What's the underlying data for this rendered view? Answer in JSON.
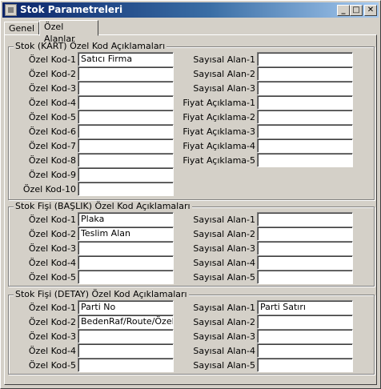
{
  "window": {
    "title": "Stok Parametreleri",
    "minimize_glyph": "_",
    "maximize_glyph": "□",
    "close_glyph": "✕"
  },
  "tabs": [
    {
      "label": "Genel",
      "active": false
    },
    {
      "label": "Özel Alanlar",
      "active": true
    }
  ],
  "groups": [
    {
      "title": "Stok (KART)  Özel Kod Açıklamaları",
      "left_fields": [
        {
          "label": "Özel Kod-1",
          "value": "Satıcı Firma"
        },
        {
          "label": "Özel Kod-2",
          "value": ""
        },
        {
          "label": "Özel Kod-3",
          "value": ""
        },
        {
          "label": "Özel Kod-4",
          "value": ""
        },
        {
          "label": "Özel Kod-5",
          "value": ""
        },
        {
          "label": "Özel Kod-6",
          "value": ""
        },
        {
          "label": "Özel Kod-7",
          "value": ""
        },
        {
          "label": "Özel Kod-8",
          "value": ""
        },
        {
          "label": "Özel Kod-9",
          "value": ""
        },
        {
          "label": "Özel Kod-10",
          "value": ""
        }
      ],
      "right_fields": [
        {
          "label": "Sayısal Alan-1",
          "value": ""
        },
        {
          "label": "Sayısal Alan-2",
          "value": ""
        },
        {
          "label": "Sayısal Alan-3",
          "value": ""
        },
        {
          "label": "Fiyat Açıklama-1",
          "value": ""
        },
        {
          "label": "Fiyat Açıklama-2",
          "value": ""
        },
        {
          "label": "Fiyat Açıklama-3",
          "value": ""
        },
        {
          "label": "Fiyat Açıklama-4",
          "value": ""
        },
        {
          "label": "Fiyat Açıklama-5",
          "value": ""
        }
      ]
    },
    {
      "title": "Stok Fişi  (BAŞLIK)  Özel Kod Açıklamaları",
      "left_fields": [
        {
          "label": "Özel Kod-1",
          "value": "Plaka"
        },
        {
          "label": "Özel Kod-2",
          "value": "Teslim Alan"
        },
        {
          "label": "Özel Kod-3",
          "value": ""
        },
        {
          "label": "Özel Kod-4",
          "value": ""
        },
        {
          "label": "Özel Kod-5",
          "value": ""
        }
      ],
      "right_fields": [
        {
          "label": "Sayısal Alan-1",
          "value": ""
        },
        {
          "label": "Sayısal Alan-2",
          "value": ""
        },
        {
          "label": "Sayısal Alan-3",
          "value": ""
        },
        {
          "label": "Sayısal Alan-4",
          "value": ""
        },
        {
          "label": "Sayısal Alan-5",
          "value": ""
        }
      ]
    },
    {
      "title": "Stok Fişi  (DETAY)  Özel Kod Açıklamaları",
      "left_fields": [
        {
          "label": "Özel Kod-1",
          "value": "Parti No"
        },
        {
          "label": "Özel Kod-2",
          "value": "BedenRaf/Route/Özel"
        },
        {
          "label": "Özel Kod-3",
          "value": ""
        },
        {
          "label": "Özel Kod-4",
          "value": ""
        },
        {
          "label": "Özel Kod-5",
          "value": ""
        }
      ],
      "right_fields": [
        {
          "label": "Sayısal Alan-1",
          "value": "Parti Satırı"
        },
        {
          "label": "Sayısal Alan-2",
          "value": ""
        },
        {
          "label": "Sayısal Alan-3",
          "value": ""
        },
        {
          "label": "Sayısal Alan-4",
          "value": ""
        },
        {
          "label": "Sayısal Alan-5",
          "value": ""
        }
      ]
    }
  ]
}
